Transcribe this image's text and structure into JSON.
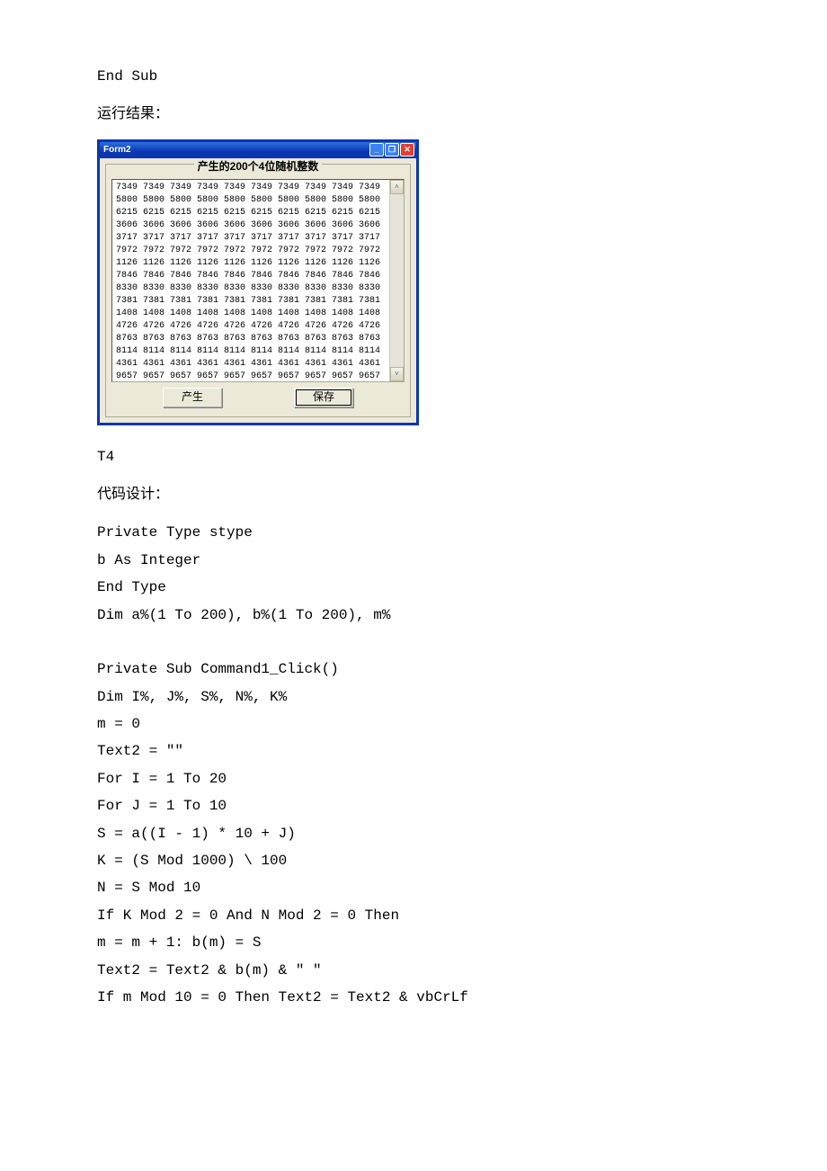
{
  "doc": {
    "code_top": "End Sub",
    "result_label": "运行结果：",
    "t4": "T4",
    "code_design": "代码设计：",
    "code_lines": [
      "Private Type stype",
      "b As Integer",
      "End Type",
      "Dim a%(1 To 200), b%(1 To 200), m%",
      "",
      "Private Sub Command1_Click()",
      "Dim I%, J%, S%, N%, K%",
      "m = 0",
      "Text2 = \"\"",
      "For I = 1 To 20",
      "For J = 1 To 10",
      "S = a((I - 1) * 10 + J)",
      "K = (S Mod 1000) \\ 100",
      "N = S Mod 10",
      "If K Mod 2 = 0 And N Mod 2 = 0 Then",
      "m = m + 1: b(m) = S",
      "Text2 = Text2 & b(m) & \"  \"",
      "If m Mod 10 = 0 Then Text2 = Text2 & vbCrLf"
    ]
  },
  "window": {
    "title": "Form2",
    "frame_title": "产生的200个4位随机整数",
    "rows": [
      "7349 7349 7349 7349 7349 7349 7349 7349 7349 7349",
      "5800 5800 5800 5800 5800 5800 5800 5800 5800 5800",
      "6215 6215 6215 6215 6215 6215 6215 6215 6215 6215",
      "3606 3606 3606 3606 3606 3606 3606 3606 3606 3606",
      "3717 3717 3717 3717 3717 3717 3717 3717 3717 3717",
      "7972 7972 7972 7972 7972 7972 7972 7972 7972 7972",
      "1126 1126 1126 1126 1126 1126 1126 1126 1126 1126",
      "7846 7846 7846 7846 7846 7846 7846 7846 7846 7846",
      "8330 8330 8330 8330 8330 8330 8330 8330 8330 8330",
      "7381 7381 7381 7381 7381 7381 7381 7381 7381 7381",
      "1408 1408 1408 1408 1408 1408 1408 1408 1408 1408",
      "4726 4726 4726 4726 4726 4726 4726 4726 4726 4726",
      "8763 8763 8763 8763 8763 8763 8763 8763 8763 8763",
      "8114 8114 8114 8114 8114 8114 8114 8114 8114 8114",
      "4361 4361 4361 4361 4361 4361 4361 4361 4361 4361",
      "9657 9657 9657 9657 9657 9657 9657 9657 9657 9657"
    ],
    "btn_generate": "产生",
    "btn_save": "保存",
    "caret_up": "˄",
    "caret_down": "˅"
  }
}
